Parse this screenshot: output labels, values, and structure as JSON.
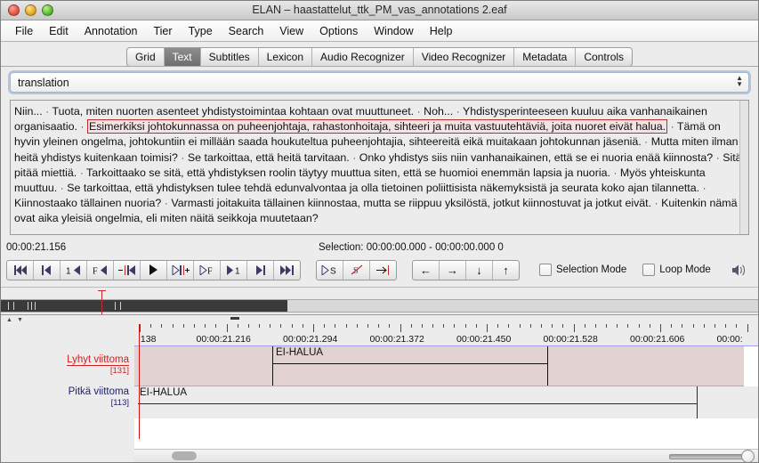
{
  "window": {
    "title": "ELAN – haastattelut_ttk_PM_vas_annotations 2.eaf",
    "buttons": {
      "close": "close-button",
      "minimize": "minimize-button",
      "maximize": "maximize-button"
    }
  },
  "menubar": {
    "items": [
      "File",
      "Edit",
      "Annotation",
      "Tier",
      "Type",
      "Search",
      "View",
      "Options",
      "Window",
      "Help"
    ]
  },
  "tabs": {
    "items": [
      "Grid",
      "Text",
      "Subtitles",
      "Lexicon",
      "Audio Recognizer",
      "Video Recognizer",
      "Metadata",
      "Controls"
    ],
    "selected": "Text"
  },
  "tier_selector": {
    "value": "translation"
  },
  "text_viewer": {
    "segments": [
      {
        "text": "Niin...",
        "highlighted": false
      },
      {
        "text": "Tuota, miten nuorten asenteet yhdistystoimintaa kohtaan ovat muuttuneet.",
        "highlighted": false
      },
      {
        "text": "Noh...",
        "highlighted": false
      },
      {
        "text": "Yhdistysperinteeseen kuuluu aika vanhanaikainen organisaatio.",
        "highlighted": false
      },
      {
        "text": "Esimerkiksi johtokunnassa on puheenjohtaja, rahastonhoitaja, sihteeri ja muita vastuutehtäviä, joita nuoret eivät halua.",
        "highlighted": true
      },
      {
        "text": "Tämä on hyvin yleinen ongelma, johtokuntiin ei millään saada houkuteltua puheenjohtajia, sihteereitä eikä muitakaan johtokunnan jäseniä.",
        "highlighted": false
      },
      {
        "text": "Mutta miten ilman heitä yhdistys kuitenkaan toimisi?",
        "highlighted": false
      },
      {
        "text": "Se tarkoittaa, että heitä tarvitaan.",
        "highlighted": false
      },
      {
        "text": "Onko yhdistys siis niin vanhanaikainen, että se ei nuoria enää kiinnosta?",
        "highlighted": false
      },
      {
        "text": "Sitä pitää miettiä.",
        "highlighted": false
      },
      {
        "text": "Tarkoittaako se sitä, että yhdistyksen roolin täytyy muuttua siten, että se huomioi enemmän lapsia ja nuoria.",
        "highlighted": false
      },
      {
        "text": "Myös yhteiskunta muuttuu.",
        "highlighted": false
      },
      {
        "text": "Se tarkoittaa, että yhdistyksen tulee tehdä edunvalvontaa ja olla tietoinen poliittisista näkemyksistä ja seurata koko ajan tilannetta.",
        "highlighted": false
      },
      {
        "text": "Kiinnostaako tällainen nuoria?",
        "highlighted": false
      },
      {
        "text": "Varmasti joitakuita tällainen kiinnostaa, mutta se riippuu yksilöstä, jotkut kiinnostuvat ja jotkut eivät.",
        "highlighted": false
      },
      {
        "text": "Kuitenkin nämä ovat aika yleisiä ongelmia, eli miten näitä seikkoja muutetaan?",
        "highlighted": false
      }
    ],
    "separator": "·"
  },
  "player": {
    "current_time": "00:00:21.156",
    "selection_label": "Selection: 00:00:00.000 - 00:00:00.000  0",
    "transport_buttons": [
      {
        "name": "go-to-begin-button",
        "glyph": "|◀◀"
      },
      {
        "name": "previous-scroll-view-button",
        "glyph": "|◀"
      },
      {
        "name": "previous-frame-button",
        "glyph": "1◀"
      },
      {
        "name": "previous-frame-f-button",
        "glyph": "F◀"
      },
      {
        "name": "pixel-left-button",
        "glyph": "-|◀"
      },
      {
        "name": "play-pause-button",
        "glyph": "▶"
      },
      {
        "name": "pixel-right-button",
        "glyph": "▶|+"
      },
      {
        "name": "next-frame-f-button",
        "glyph": "▶F"
      },
      {
        "name": "next-frame-button",
        "glyph": "▶1"
      },
      {
        "name": "next-scroll-view-button",
        "glyph": "▶|"
      },
      {
        "name": "go-to-end-button",
        "glyph": "▶▶|"
      }
    ],
    "selection_buttons": [
      {
        "name": "play-selection-button",
        "glyph": "▷S"
      },
      {
        "name": "clear-selection-button",
        "glyph": "S"
      },
      {
        "name": "move-crosshair-to-selection-button",
        "glyph": "→|"
      }
    ],
    "annotation_nav_buttons": [
      {
        "name": "previous-annotation-button",
        "glyph": "←"
      },
      {
        "name": "next-annotation-button",
        "glyph": "→"
      },
      {
        "name": "annotation-down-button",
        "glyph": "↓"
      },
      {
        "name": "annotation-up-button",
        "glyph": "↑"
      }
    ],
    "selection_mode": {
      "label": "Selection Mode",
      "checked": false
    },
    "loop_mode": {
      "label": "Loop Mode",
      "checked": false
    },
    "volume_icon": "speaker-icon"
  },
  "timeline": {
    "ruler_labels": [
      ".138",
      "00:00:21.216",
      "00:00:21.294",
      "00:00:21.372",
      "00:00:21.450",
      "00:00:21.528",
      "00:00:21.606",
      "00:00:"
    ],
    "tiers": [
      {
        "name": "Lyhyt viittoma",
        "count": "[131]",
        "active": true,
        "annotation": "EI-HALUA"
      },
      {
        "name": "Pitkä viittoma",
        "count": "[113]",
        "active": false,
        "annotation": "EI-HALUA"
      }
    ]
  },
  "colors": {
    "active_tier_text": "#d02020",
    "inactive_tier_text": "#1d1d6e",
    "active_row_background": "#e3d2d2",
    "crosshair": "#d41010",
    "highlight_border": "#c02b2b"
  }
}
